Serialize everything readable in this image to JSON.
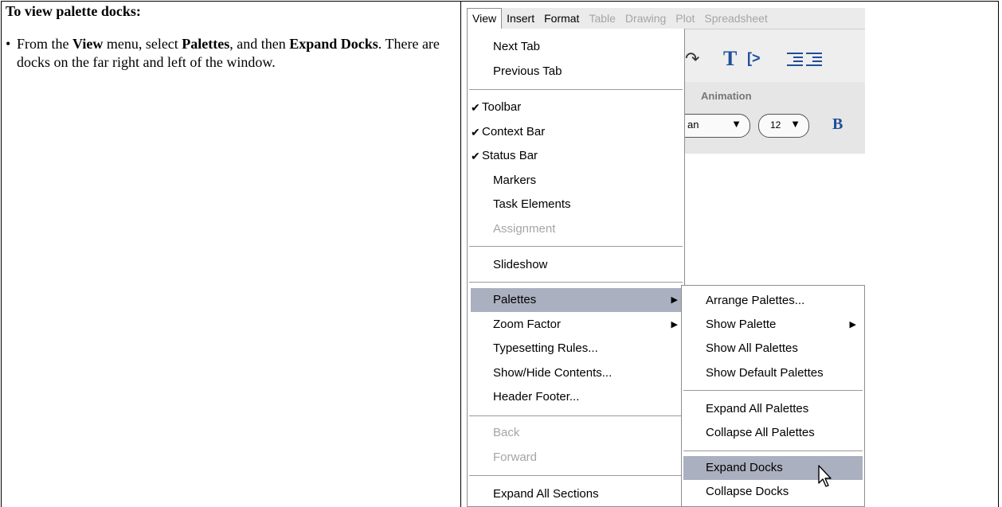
{
  "instructions": {
    "heading": "To view palette docks:",
    "bullet": "•",
    "step_prefix": "From the ",
    "step_view": "View",
    "step_mid1": " menu, select ",
    "step_palettes": "Palettes",
    "step_mid2": ", and then ",
    "step_expand": "Expand Docks",
    "step_suffix": ". There are docks on the far right and left of the window."
  },
  "menubar": {
    "items": [
      "View",
      "Insert",
      "Format",
      "Table",
      "Drawing",
      "Plot",
      "Spreadsheet"
    ]
  },
  "toolbar": {
    "redo_glyph": "↷",
    "text_glyph": "T",
    "tag_glyph": "[>",
    "context_tab": "Animation",
    "font_value": "an",
    "size_value": "12",
    "dropdown_glyph": "▼",
    "bold_glyph": "B"
  },
  "view_menu": {
    "check_glyph": "✔",
    "submenu_glyph": "▶",
    "items": [
      {
        "label": "Next Tab"
      },
      {
        "label": "Previous Tab"
      },
      {
        "label": "Toolbar",
        "checked": true
      },
      {
        "label": "Context Bar",
        "checked": true
      },
      {
        "label": "Status Bar",
        "checked": true
      },
      {
        "label": "Markers"
      },
      {
        "label": "Task Elements"
      },
      {
        "label": "Assignment",
        "disabled": true
      },
      {
        "label": "Slideshow"
      },
      {
        "label": "Palettes",
        "highlighted": true,
        "has_submenu": true
      },
      {
        "label": "Zoom Factor",
        "has_submenu": true
      },
      {
        "label": "Typesetting Rules..."
      },
      {
        "label": "Show/Hide Contents..."
      },
      {
        "label": "Header Footer..."
      },
      {
        "label": "Back",
        "disabled": true
      },
      {
        "label": "Forward",
        "disabled": true
      },
      {
        "label": "Expand All Sections"
      }
    ]
  },
  "palettes_submenu": {
    "items": [
      {
        "label": "Arrange Palettes..."
      },
      {
        "label": "Show Palette",
        "has_submenu": true
      },
      {
        "label": "Show All Palettes"
      },
      {
        "label": "Show Default Palettes"
      },
      {
        "label": "Expand All Palettes"
      },
      {
        "label": "Collapse All Palettes"
      },
      {
        "label": "Expand Docks",
        "highlighted": true
      },
      {
        "label": "Collapse Docks"
      }
    ]
  }
}
